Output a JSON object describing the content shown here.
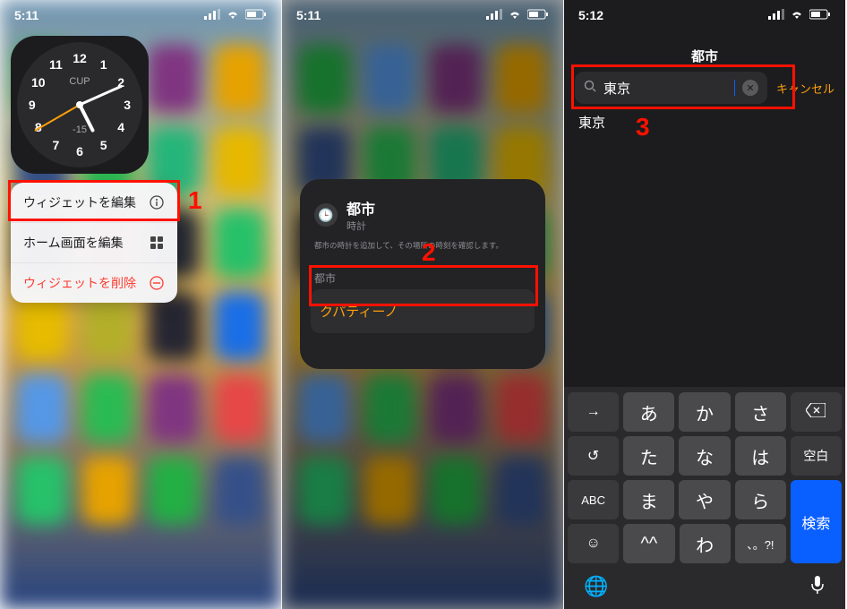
{
  "panel1": {
    "status": {
      "time": "5:11"
    },
    "clock": {
      "label_top": "CUP",
      "label_bottom": "-15",
      "numbers": [
        "12",
        "1",
        "2",
        "3",
        "4",
        "5",
        "6",
        "7",
        "8",
        "9",
        "10",
        "11"
      ]
    },
    "menu": {
      "edit_widget": "ウィジェットを編集",
      "edit_home": "ホーム画面を編集",
      "delete": "ウィジェットを削除"
    },
    "annotation": "1"
  },
  "panel2": {
    "status": {
      "time": "5:11"
    },
    "editor": {
      "title": "都市",
      "subtitle_line": "時計",
      "description": "都市の時計を追加して、その場所の時刻を確認します。",
      "section_label": "都市",
      "selected_city": "クパティーノ"
    },
    "annotation": "2"
  },
  "panel3": {
    "status": {
      "time": "5:12"
    },
    "header_title": "都市",
    "search_value": "東京",
    "cancel_label": "キャンセル",
    "results": [
      "東京"
    ],
    "annotation": "3",
    "keyboard": {
      "row1": [
        "→",
        "あ",
        "か",
        "さ",
        "⌫"
      ],
      "row2": [
        "↺",
        "た",
        "な",
        "は",
        "空白"
      ],
      "row3": [
        "ABC",
        "ま",
        "や",
        "ら"
      ],
      "row4": [
        "☺",
        "^^",
        "わ",
        "、。?!"
      ],
      "search_key": "検索",
      "globe": "🌐",
      "mic": "🎤"
    }
  }
}
